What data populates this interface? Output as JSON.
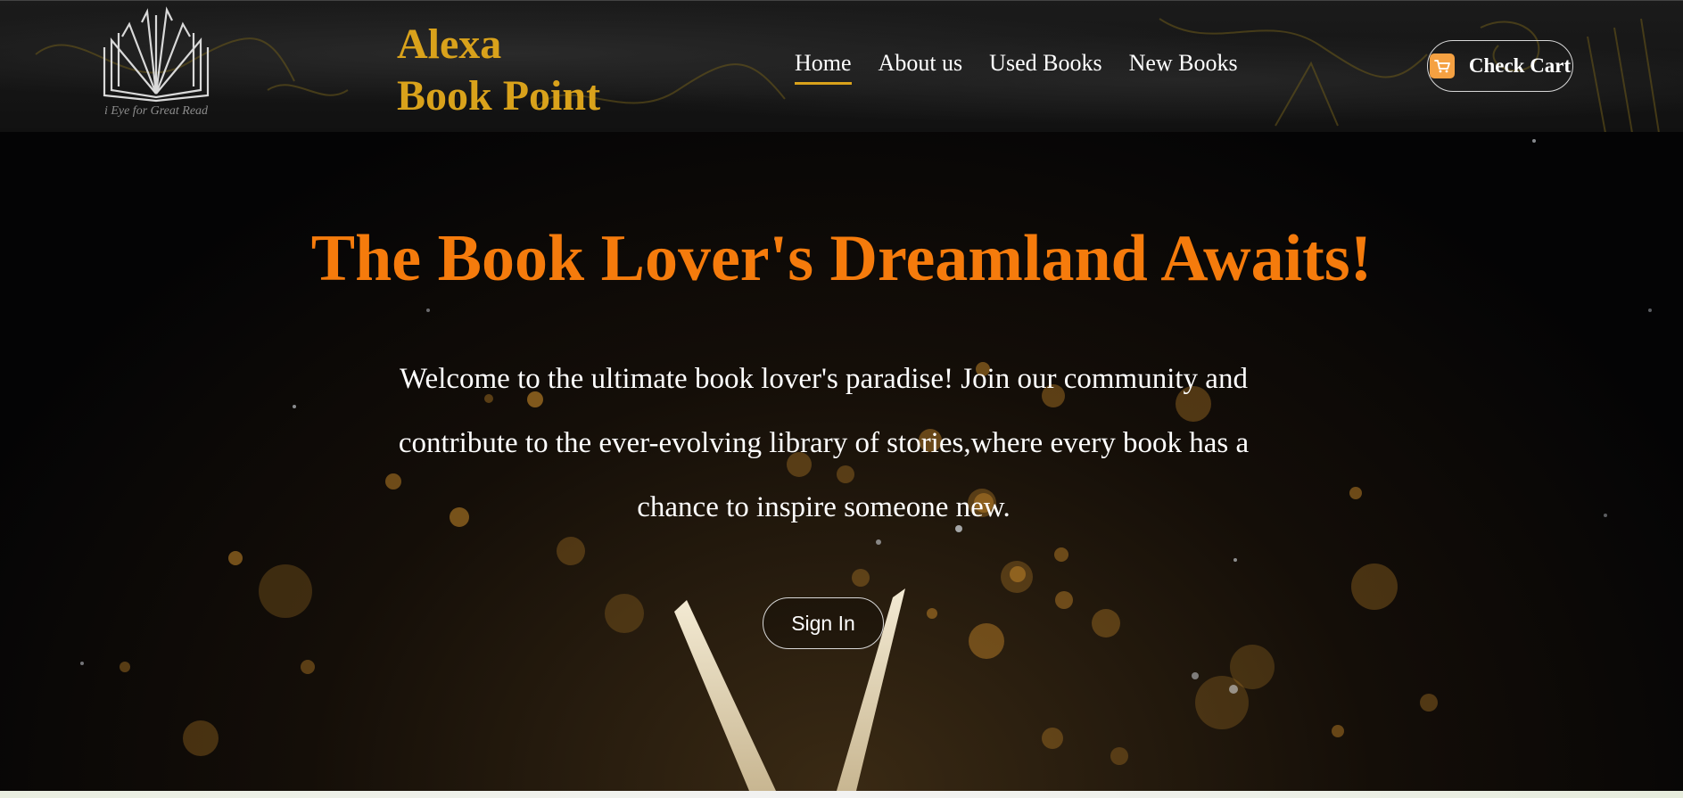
{
  "header": {
    "logo": {
      "icon": "open-book-icon",
      "tagline": "i Eye for Great Read"
    },
    "brand": {
      "line1": "Alexa",
      "line2": "Book Point"
    },
    "nav": [
      {
        "label": "Home",
        "active": true
      },
      {
        "label": "About us",
        "active": false
      },
      {
        "label": "Used Books",
        "active": false
      },
      {
        "label": "New Books",
        "active": false
      }
    ],
    "cart": {
      "icon": "shopping-cart-icon",
      "label": "Check Cart"
    }
  },
  "hero": {
    "title": "The Book Lover's Dreamland Awaits!",
    "line1": "Welcome to the ultimate book lover's paradise! Join our community and",
    "line2": "contribute to the ever-evolving library of stories,where every book has a",
    "line3": "chance to inspire someone new.",
    "signin_label": "Sign In"
  },
  "colors": {
    "brand": "#d9a21b",
    "hero_title": "#f57b0c",
    "cart_icon_bg": "#f5a142",
    "text": "#ffffff",
    "background": "#050505"
  }
}
